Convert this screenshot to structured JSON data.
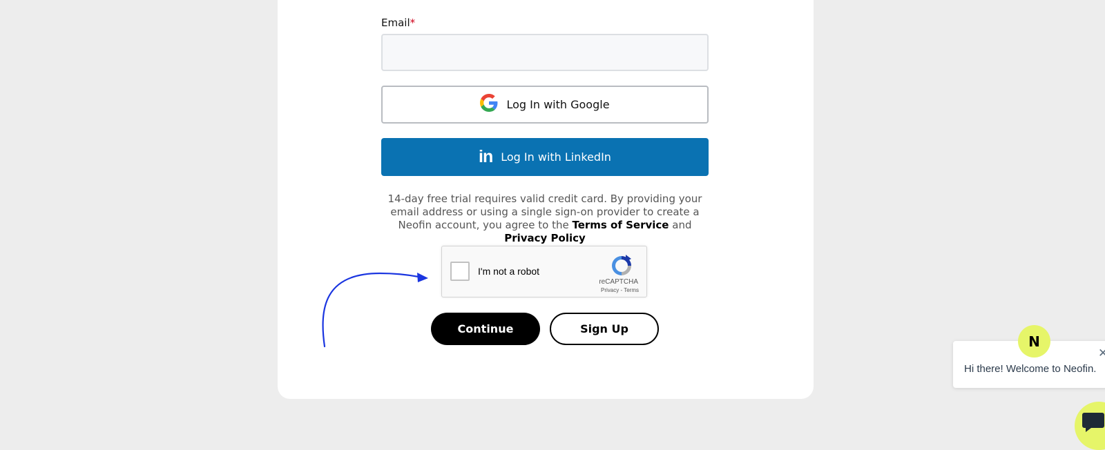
{
  "form": {
    "email_label": "Email",
    "email_required_mark": "*",
    "email_value": "",
    "email_placeholder": ""
  },
  "google_button": {
    "label": "Log In with Google",
    "icon": "google-icon"
  },
  "linkedin_button": {
    "label": "Log In with LinkedIn",
    "icon": "linkedin-icon",
    "icon_text": "in"
  },
  "disclaimer": {
    "text_before": "14-day free trial requires valid credit card. By providing your email address or using a single sign-on provider to create a Neofin account, you agree to the ",
    "terms_link": "Terms of Service",
    "and": " and ",
    "privacy_link": "Privacy Policy"
  },
  "recaptcha": {
    "label": "I'm not a robot",
    "brand": "reCAPTCHA",
    "privacy": "Privacy",
    "separator": " - ",
    "terms": "Terms"
  },
  "actions": {
    "continue_label": "Continue",
    "signup_label": "Sign Up"
  },
  "chat": {
    "greeting": "Hi there! Welcome to Neofin.",
    "avatar_letter": "N",
    "close_symbol": "✕"
  },
  "colors": {
    "linkedin_blue": "#0a72b2",
    "required_red": "#d0021b",
    "chat_accent": "#e6f569",
    "arrow_blue": "#1a35e0"
  }
}
